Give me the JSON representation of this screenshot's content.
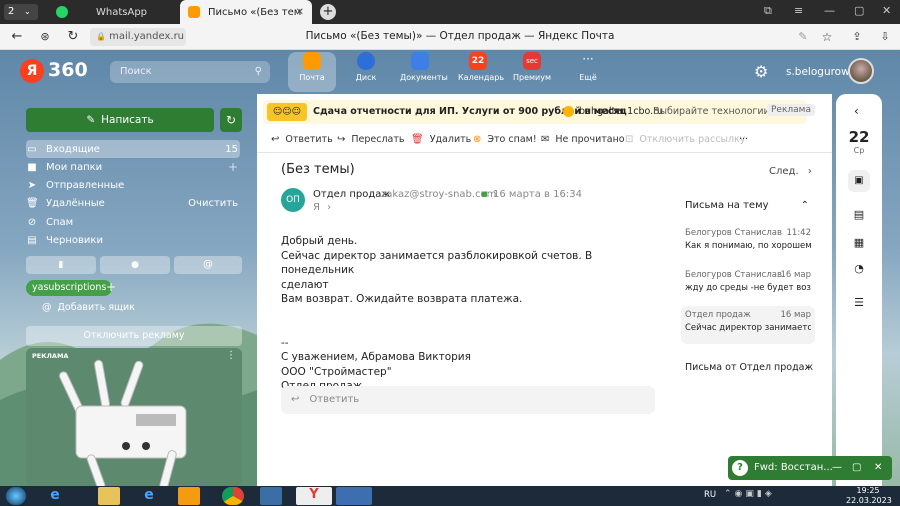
{
  "browser": {
    "tab_count": "2",
    "tabs": [
      {
        "label": "WhatsApp"
      },
      {
        "label": "Письмо «(Без темы)» —"
      }
    ],
    "url": "mail.yandex.ru",
    "page_title": "Письмо «(Без темы)» — Отдел продаж — Яндекс Почта"
  },
  "header": {
    "logo_ya": "Я",
    "logo_360": "360",
    "search_placeholder": "Поиск",
    "services": [
      "Почта",
      "Диск",
      "Документы",
      "Календарь",
      "Премиум",
      "Ещё"
    ],
    "calendar_badge": "22",
    "premium_badge": "sec",
    "username": "s.belogurow"
  },
  "sidebar": {
    "compose_label": "Написать",
    "folders": [
      {
        "label": "Входящие",
        "count": "15"
      },
      {
        "label": "Мои папки",
        "count": "+"
      },
      {
        "label": "Отправленные",
        "count": ""
      },
      {
        "label": "Удалённые",
        "count": "Очистить"
      },
      {
        "label": "Спам",
        "count": ""
      },
      {
        "label": "Черновики",
        "count": ""
      }
    ],
    "label_tag": "yasubscriptions",
    "add_mailbox": "Добавить ящик",
    "disable_ads": "Отключить рекламу",
    "ad_label": "РЕКЛАМА"
  },
  "ad_banner": {
    "text": "Сдача отчетности для ИП. Услуги от 900 рублей в месяц",
    "domain": "buhgalter.1cbo.ru",
    "more": "Выбирайте технологии...",
    "badge": "Реклама"
  },
  "toolbar": {
    "reply": "Ответить",
    "forward": "Переслать",
    "delete": "Удалить",
    "spam": "Это спам!",
    "unread": "Не прочитано",
    "unsubscribe": "Отключить рассылку",
    "more": "···"
  },
  "message": {
    "subject": "(Без темы)",
    "next": "След.",
    "avatar": "ОП",
    "sender_name": "Отдел продаж",
    "sender_email": "zakaz@stroy-snab.com",
    "date": "16 марта в 16:34",
    "to": "Я",
    "body": [
      "Добрый день.",
      "Сейчас директор занимается разблокировкой счетов. В понедельник",
      "сделают",
      "Вам возврат. Ожидайте возврата платежа.",
      "",
      "",
      "--",
      "С уважением, Абрамова Виктория",
      "ООО \"Строймастер\"",
      "Отдел продаж"
    ],
    "reply_placeholder": "Ответить"
  },
  "thread": {
    "title": "Письма на тему",
    "items": [
      {
        "sender": "Белогуров Станислав",
        "time": "11:42",
        "snippet": "Как я понимаю, по хорошему..."
      },
      {
        "sender": "Белогуров Станислав",
        "time": "16 мар",
        "snippet": "жду до среды -не будет возв..."
      },
      {
        "sender": "Отдел продаж",
        "time": "16 мар",
        "snippet": "Сейчас директор занимаетс..."
      }
    ],
    "from_sender": "Письма от Отдел продаж"
  },
  "right_panel": {
    "day": "22",
    "weekday": "Ср"
  },
  "notification": {
    "title": "Fwd: Восстан..."
  },
  "taskbar": {
    "lang": "RU",
    "time": "19:25",
    "date": "22.03.2023"
  },
  "colors": {
    "compose_green": "#2e7d32",
    "accent_orange": "#ff9900",
    "brand_red": "#fc3f1d"
  }
}
